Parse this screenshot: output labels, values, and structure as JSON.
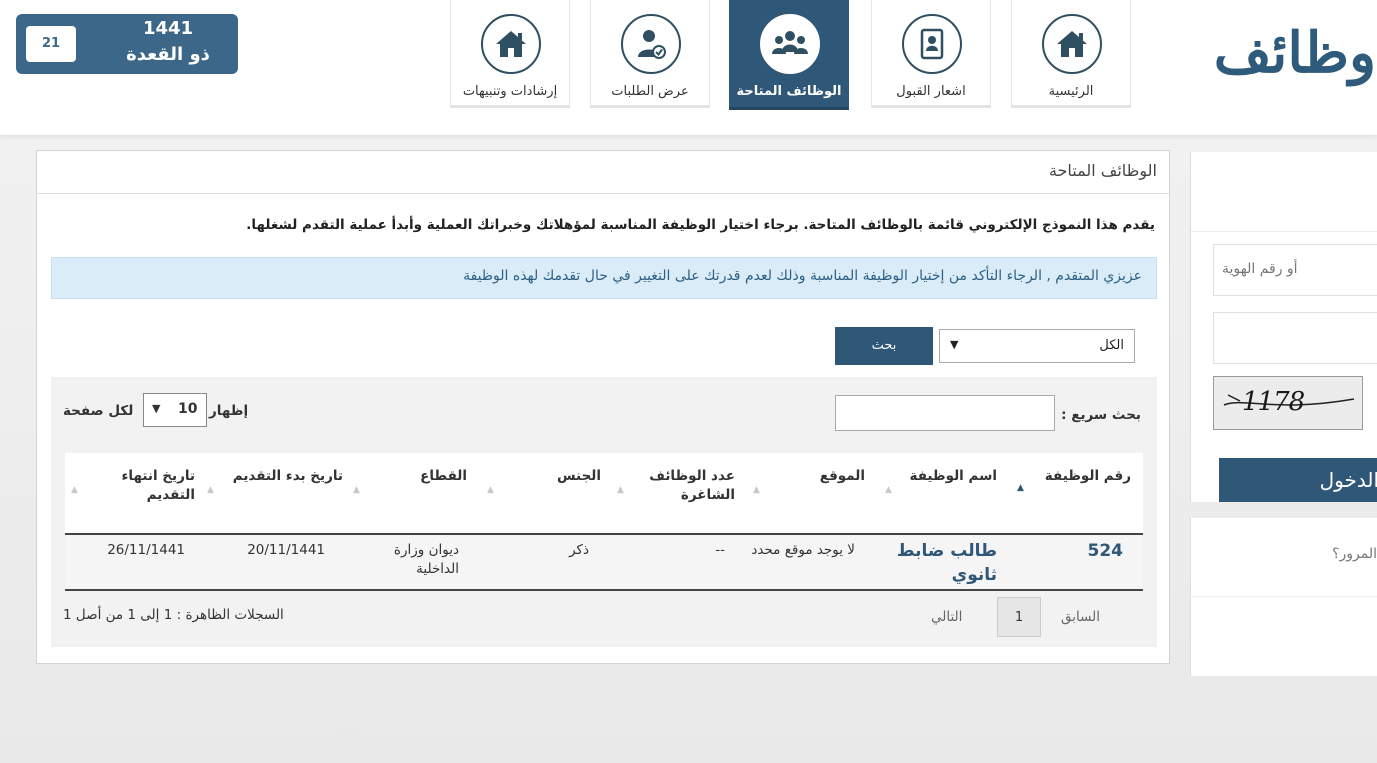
{
  "date": {
    "day": "21",
    "year": "1441",
    "month": "ذو القعدة"
  },
  "logo": {
    "text": "وظائف"
  },
  "nav": {
    "home": "الرئيسية",
    "acceptance": "اشعار القبول",
    "jobs": "الوظائف المتاحة",
    "requests": "عرض الطلبات",
    "guidance": "إرشادات وتنبيهات"
  },
  "panel": {
    "title": "الوظائف المتاحة",
    "intro": "يقدم هذا النموذج الإلكتروني قائمة بالوظائف المتاحة. برجاء اختيار الوظيفة المناسبة لمؤهلاتك وخبراتك العملية وأبدأ عملية التقدم لشغلها.",
    "alert": "عزيزي المتقدم , الرجاء التأكد من إختيار الوظيفة المناسبة وذلك لعدم قدرتك على التغيير في حال تقدمك لهذه الوظيفة",
    "filter_value": "الكل",
    "search_label": "بحث"
  },
  "table": {
    "quick_search_label": "بحث سريع :",
    "show_label": "إظهار",
    "page_length": "10",
    "per_page_label": "لكل صفحة",
    "headers": {
      "job_no": "رقم الوظيفة",
      "job_name": "اسم الوظيفة",
      "location": "الموقع",
      "vacancies": "عدد الوظائف الشاغرة",
      "gender": "الجنس",
      "sector": "القطاع",
      "start_date": "تاريخ بدء التقديم",
      "end_date": "تاريخ انتهاء التقديم"
    },
    "rows": [
      {
        "job_no": "524",
        "job_name": "طالب ضابط ثانوي",
        "location": "لا يوجد موقع محدد",
        "vacancies": "--",
        "gender": "ذكر",
        "sector": "ديوان وزارة الداخلية",
        "start_date": "20/11/1441",
        "end_date": "26/11/1441"
      }
    ],
    "pager": {
      "prev": "السابق",
      "page": "1",
      "next": "التالي"
    },
    "records": "السجلات الظاهرة : 1 إلى 1 من أصل 1"
  },
  "login": {
    "id_placeholder": "أو رقم الهوية",
    "captcha": "1178",
    "button": "الدخول",
    "forgot": "المرور؟"
  },
  "colors": {
    "primary": "#2f5777",
    "alert_bg": "#d9ecf7"
  },
  "icons": {
    "home": "home-icon",
    "acceptance": "document-user-icon",
    "jobs": "group-icon",
    "requests": "user-check-icon",
    "guidance": "home-icon"
  }
}
